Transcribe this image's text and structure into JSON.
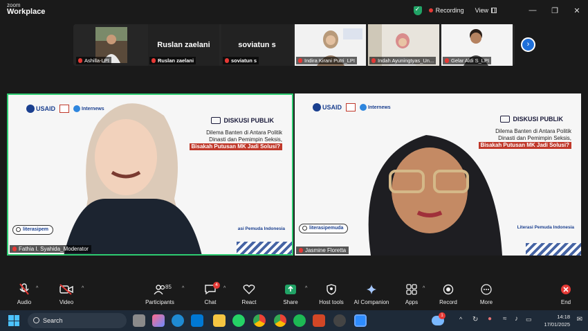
{
  "app": {
    "brand_line1": "zoom",
    "brand_line2": "Workplace"
  },
  "titlebar": {
    "recording_label": "Recording",
    "view_label": "View"
  },
  "strip": [
    {
      "name": "Ashilla-LPI",
      "type": "video"
    },
    {
      "name": "Ruslan zaelani",
      "display": "Ruslan zaelani",
      "type": "text"
    },
    {
      "name": "soviatun s",
      "display": "soviatun s",
      "type": "text"
    },
    {
      "name": "Indira Kirani Putri_LPI",
      "type": "video"
    },
    {
      "name": "Indah Ayuningtyas_Un...",
      "type": "video"
    },
    {
      "name": "Gelar Aldi S_LPI",
      "type": "video"
    }
  ],
  "main": {
    "left": {
      "name": "Fathia I. Syahida_Moderator",
      "search_text": "literasipem",
      "org_text": "asi Pemuda Indonesia",
      "headline_lines": [
        "Dilema Banten di Antara Politik",
        "Dinasti dan Pemimpin Seksis,"
      ],
      "headline_highlight": "Bisakah Putusan MK Jadi Solusi?"
    },
    "right": {
      "name": "Jasmine Floretta",
      "search_text": "literasipemuda",
      "org_text": "Literasi Pemuda Indonesia",
      "headline_lines": [
        "Dilema Banten di Antara Politik",
        "Dinasti dan Pemimpin Seksis,"
      ],
      "headline_highlight": "Bisakah Putusan MK Jadi Solusi?"
    },
    "banner": {
      "usaid": "USAID",
      "internews": "Internews",
      "diskusi": "DISKUSI PUBLIK"
    }
  },
  "toolbar": {
    "audio": "Audio",
    "video": "Video",
    "participants": "Participants",
    "participants_count": "85",
    "chat": "Chat",
    "chat_badge": "4",
    "react": "React",
    "share": "Share",
    "host_tools": "Host tools",
    "ai_companion": "AI Companion",
    "apps": "Apps",
    "record": "Record",
    "more": "More",
    "end": "End"
  },
  "taskbar": {
    "search_placeholder": "Search",
    "notif_badge": "1",
    "time": "14:18",
    "date": "17/01/2025"
  },
  "colors": {
    "accent_blue": "#1e6fd9",
    "active_speaker": "#2ecc71",
    "record_red": "#e53935",
    "share_green": "#21a366"
  }
}
